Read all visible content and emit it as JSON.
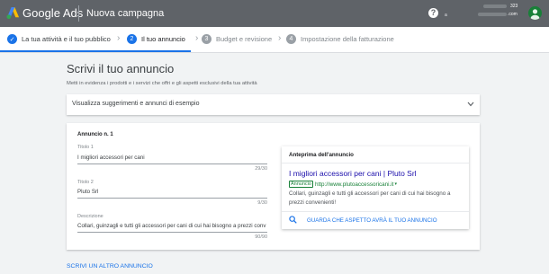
{
  "header": {
    "brand": "Google Ads",
    "campaign": "Nuova campagna",
    "help_symbol": "?",
    "account_prefix": "a",
    "account_number": "323",
    "account_suffix": ".com",
    "icons": {
      "logo": "google-ads-logo",
      "help": "help-icon",
      "avatar": "avatar"
    }
  },
  "stepper": {
    "steps": [
      {
        "marker": "✓",
        "label": "La tua attività e il tuo pubblico",
        "state": "done"
      },
      {
        "marker": "2",
        "label": "Il tuo annuncio",
        "state": "active"
      },
      {
        "marker": "3",
        "label": "Budget e revisione",
        "state": "upcoming"
      },
      {
        "marker": "4",
        "label": "Impostazione della fatturazione",
        "state": "upcoming"
      }
    ],
    "chevron": "›"
  },
  "main": {
    "title": "Scrivi il tuo annuncio",
    "subtitle": "Metti in evidenza i prodotti e i servizi che offri e gli aspetti esclusivi della tua attività",
    "suggestions": {
      "label": "Visualizza suggerimenti e annunci di esempio",
      "icon": "chevron-down-icon"
    },
    "ad": {
      "heading": "Annuncio n. 1",
      "fields": [
        {
          "label": "Titolo 1",
          "value": "I migliori accessori per cani",
          "count": "29/30"
        },
        {
          "label": "Titolo 2",
          "value": "Pluto Srl",
          "count": "9/30"
        },
        {
          "label": "Descrizione",
          "value": "Collari, guinzagli e tutti gli accessori per cani di cui hai bisogno a prezzi conv",
          "count": "90/90"
        }
      ]
    },
    "preview": {
      "title": "Anteprima dell'annuncio",
      "headline": "I migliori accessori per cani | Pluto Srl",
      "badge": "Annuncio",
      "url": "http://www.plutoaccessoricani.it",
      "url_arrow": "▾",
      "description": "Collari, guinzagli e tutti gli accessori per cani di cui hai bisogno a prezzi convenienti!",
      "link": "GUARDA CHE ASPETTO AVRÀ IL TUO ANNUNCIO",
      "link_icon": "search-icon"
    },
    "add_more": "SCRIVI UN ALTRO ANNUNCIO"
  },
  "colors": {
    "topbar": "#5f6368",
    "accent": "#1a73e8",
    "done_step": "#1a73e8",
    "upcoming_step": "#9aa0a6",
    "ad_green": "#188038",
    "headline_blue": "#1a0dab"
  }
}
